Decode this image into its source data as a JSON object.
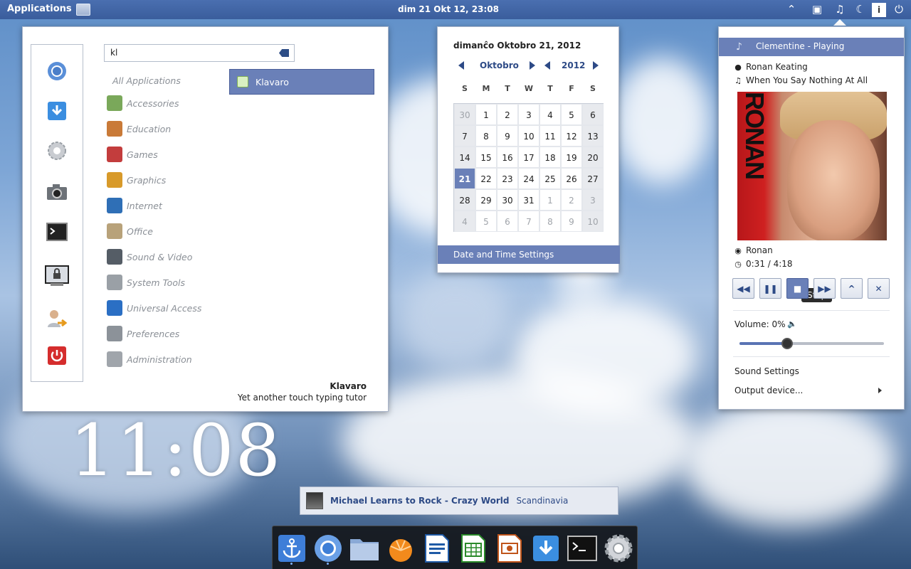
{
  "top_panel": {
    "applications_label": "Applications",
    "clock": "dim 21 Okt 12, 23:08",
    "tray_icons": [
      "chevron-up-icon",
      "network-icon",
      "music-note-icon",
      "moon-icon",
      "info-icon",
      "power-icon"
    ],
    "info_glyph": "i"
  },
  "app_menu": {
    "favorites": [
      "chromium-icon",
      "download-icon",
      "settings-icon",
      "camera-icon",
      "terminal-icon",
      "lock-screen-icon",
      "user-switch-icon",
      "power-icon"
    ],
    "search_value": "kl",
    "all_applications_label": "All Applications",
    "categories": [
      {
        "label": "Accessories",
        "color": "#7aa85a"
      },
      {
        "label": "Education",
        "color": "#c97a38"
      },
      {
        "label": "Games",
        "color": "#c33d3d"
      },
      {
        "label": "Graphics",
        "color": "#d89a2a"
      },
      {
        "label": "Internet",
        "color": "#2f6fb6"
      },
      {
        "label": "Office",
        "color": "#b8a27a"
      },
      {
        "label": "Sound & Video",
        "color": "#555d66"
      },
      {
        "label": "System Tools",
        "color": "#9aa0a6"
      },
      {
        "label": "Universal Access",
        "color": "#2b6fc4"
      },
      {
        "label": "Preferences",
        "color": "#8c9299"
      },
      {
        "label": "Administration",
        "color": "#a0a5ab"
      }
    ],
    "result_label": "Klavaro",
    "desc_title": "Klavaro",
    "desc_text": "Yet another touch typing tutor"
  },
  "calendar": {
    "full_date": "dimanĉo Oktobro 21, 2012",
    "month": "Oktobro",
    "year": "2012",
    "weekdays": [
      "S",
      "M",
      "T",
      "W",
      "T",
      "F",
      "S"
    ],
    "weeks": [
      [
        "30",
        "1",
        "2",
        "3",
        "4",
        "5",
        "6"
      ],
      [
        "7",
        "8",
        "9",
        "10",
        "11",
        "12",
        "13"
      ],
      [
        "14",
        "15",
        "16",
        "17",
        "18",
        "19",
        "20"
      ],
      [
        "21",
        "22",
        "23",
        "24",
        "25",
        "26",
        "27"
      ],
      [
        "28",
        "29",
        "30",
        "31",
        "1",
        "2",
        "3"
      ],
      [
        "4",
        "5",
        "6",
        "7",
        "8",
        "9",
        "10"
      ]
    ],
    "today": "21",
    "settings_label": "Date and Time Settings"
  },
  "sound_menu": {
    "player_title": "Clementine - Playing",
    "artist": "Ronan Keating",
    "track": "When You Say Nothing At All",
    "album_art_text": "RONAN",
    "album": "Ronan",
    "time": "0:31 / 4:18",
    "controls": [
      {
        "name": "previous-button",
        "glyph": "◀◀"
      },
      {
        "name": "pause-button",
        "glyph": "❚❚"
      },
      {
        "name": "stop-button",
        "glyph": "■"
      },
      {
        "name": "next-button",
        "glyph": "▶▶"
      },
      {
        "name": "raise-button",
        "glyph": "^"
      },
      {
        "name": "close-player-button",
        "glyph": "✕"
      }
    ],
    "stop_tooltip": "Stop",
    "volume_label": "Volume: 0%",
    "volume_level": 0.33,
    "sound_settings_label": "Sound Settings",
    "output_device_label": "Output device..."
  },
  "desktop_clock": "11:08",
  "notification": {
    "title": "Michael Learns to Rock - Crazy World",
    "album": "Scandinavia"
  },
  "dock": {
    "items": [
      "anchor-icon",
      "chromium-icon",
      "folder-icon",
      "clementine-icon",
      "writer-icon",
      "calc-icon",
      "impress-icon",
      "download-icon",
      "terminal-icon",
      "settings-icon"
    ],
    "running": [
      0,
      1
    ]
  }
}
